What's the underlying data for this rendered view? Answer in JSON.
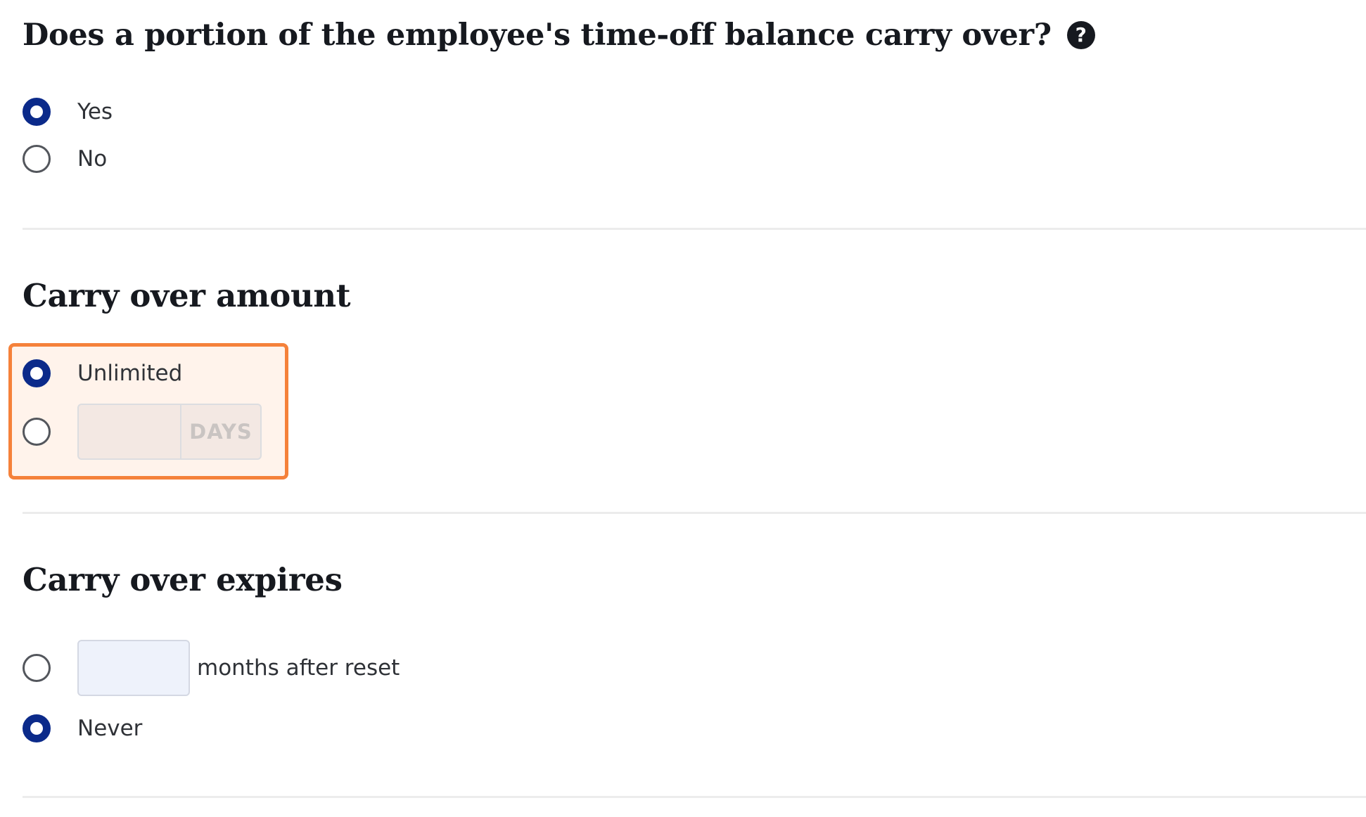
{
  "carry_over_question": {
    "title": "Does a portion of the employee's time-off balance carry over?",
    "help_icon": "question-circle-icon",
    "options": [
      {
        "label": "Yes",
        "selected": true
      },
      {
        "label": "No",
        "selected": false
      }
    ]
  },
  "carry_over_amount": {
    "title": "Carry over amount",
    "options": [
      {
        "label": "Unlimited",
        "selected": true
      },
      {
        "label": "",
        "selected": false
      }
    ],
    "days_input": {
      "value": "",
      "placeholder": ""
    },
    "days_unit": "DAYS",
    "highlight_color": "#f5813a"
  },
  "carry_over_expires": {
    "title": "Carry over expires",
    "months_input": {
      "value": "",
      "placeholder": ""
    },
    "months_label": "months after reset",
    "options": [
      {
        "label": "months after reset",
        "selected": false
      },
      {
        "label": "Never",
        "selected": true
      }
    ]
  },
  "colors": {
    "radio_selected": "#0b2a8a",
    "heading_text": "#16191f",
    "highlight_border": "#f5813a",
    "highlight_background": "#fff3eb"
  }
}
